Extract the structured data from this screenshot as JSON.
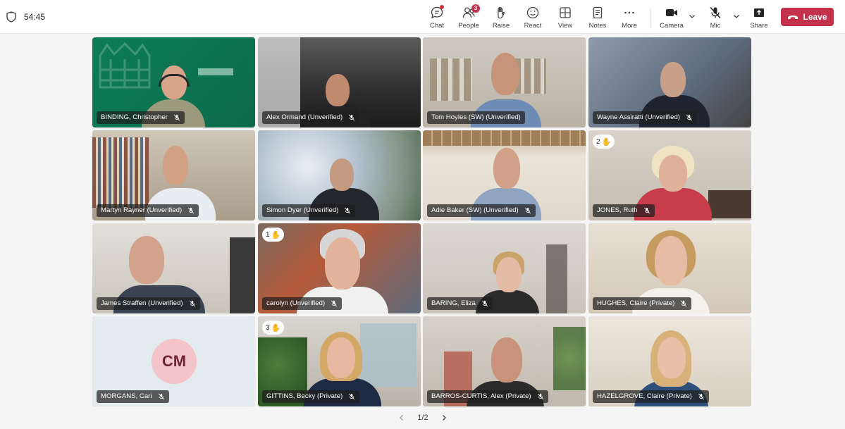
{
  "meeting": {
    "timer": "54:45"
  },
  "toolbar": {
    "chat": "Chat",
    "people": "People",
    "people_count": "3",
    "raise": "Raise",
    "react": "React",
    "view": "View",
    "notes": "Notes",
    "more": "More",
    "camera": "Camera",
    "mic": "Mic",
    "share": "Share",
    "leave": "Leave"
  },
  "participants": [
    {
      "name": "BINDING, Christopher",
      "muted": true
    },
    {
      "name": "Alex Ormand (Unverified)",
      "muted": true
    },
    {
      "name": "Tom Hoyles (SW) (Unverified)",
      "muted": false,
      "speaking": true
    },
    {
      "name": "Wayne Assiratti (Unverified)",
      "muted": true
    },
    {
      "name": "Martyn Rayner (Unverified)",
      "muted": true
    },
    {
      "name": "Simon Dyer (Unverified)",
      "muted": true
    },
    {
      "name": "Adie Baker (SW) (Unverified)",
      "muted": true
    },
    {
      "name": "JONES, Ruth",
      "muted": true,
      "hand_order": "2"
    },
    {
      "name": "James Straffen (Unverified)",
      "muted": true
    },
    {
      "name": "carolyn (Unverified)",
      "muted": true,
      "hand_order": "1"
    },
    {
      "name": "BARING, Eliza",
      "muted": true
    },
    {
      "name": "HUGHES, Claire (Private)",
      "muted": true
    },
    {
      "name": "MORGANS, Cari",
      "muted": true,
      "initials": "CM"
    },
    {
      "name": "GITTINS, Becky (Private)",
      "muted": true,
      "hand_order": "3"
    },
    {
      "name": "BARROS-CURTIS, Alex (Private)",
      "muted": true
    },
    {
      "name": "HAZELGROVE, Claire (Private)",
      "muted": true
    }
  ],
  "pagination": {
    "label": "1/2"
  },
  "colors": {
    "leave": "#c4314b",
    "speaking_border": "#6264a7",
    "raised_hand_border": "#e8b23a"
  }
}
